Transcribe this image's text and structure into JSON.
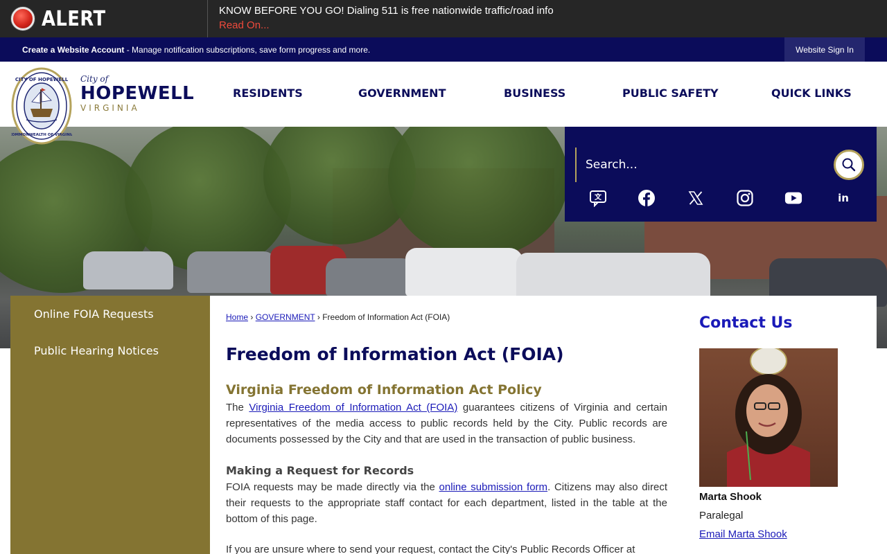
{
  "alert": {
    "label": "ALERT",
    "message": "KNOW BEFORE YOU GO! Dialing 511 is free nationwide traffic/road info",
    "link": "Read On..."
  },
  "account_bar": {
    "create_label": "Create a Website Account",
    "description": " - Manage notification subscriptions, save form progress and more.",
    "signin_label": "Website Sign In"
  },
  "logo": {
    "city_of": "City of",
    "name": "HOPEWELL",
    "state": "VIRGINIA"
  },
  "nav": [
    "RESIDENTS",
    "GOVERNMENT",
    "BUSINESS",
    "PUBLIC SAFETY",
    "QUICK LINKS"
  ],
  "search": {
    "placeholder": "Search..."
  },
  "social_icons": [
    "translate-icon",
    "facebook-icon",
    "x-icon",
    "instagram-icon",
    "youtube-icon",
    "linkedin-icon"
  ],
  "sidebar": {
    "items": [
      {
        "label": "Online FOIA Requests"
      },
      {
        "label": "Public Hearing Notices"
      }
    ]
  },
  "breadcrumb": {
    "home": "Home",
    "sep1": "›",
    "government": "GOVERNMENT",
    "sep2": "›",
    "current": "Freedom of Information Act (FOIA)"
  },
  "main": {
    "title": "Freedom of Information Act (FOIA)",
    "section1_heading": "Virginia Freedom of Information Act Policy",
    "para1_before": "The ",
    "para1_link": "Virginia Freedom of Information Act (FOIA)",
    "para1_after": " guarantees citizens of Virginia and certain representatives of the media access to public records held by the City. Public records are documents possessed by the City and that are used in the transaction of public business.",
    "section2_heading": "Making a Request for Records",
    "para2_before": "FOIA requests may be made directly via the ",
    "para2_link": "online submission form",
    "para2_after": ". Citizens may also direct their requests to the appropriate staff contact for each department, listed in the table at the bottom of this page.",
    "para3": "If you are unsure where to send your request, contact the City's Public Records Officer at"
  },
  "contact": {
    "title": "Contact Us",
    "name": "Marta Shook",
    "role": "Paralegal",
    "email_label": "Email Marta Shook"
  },
  "colors": {
    "navy": "#0b0c5a",
    "gold": "#847432",
    "alert_red": "#ef4a3c",
    "link_blue": "#1a1ab8"
  }
}
